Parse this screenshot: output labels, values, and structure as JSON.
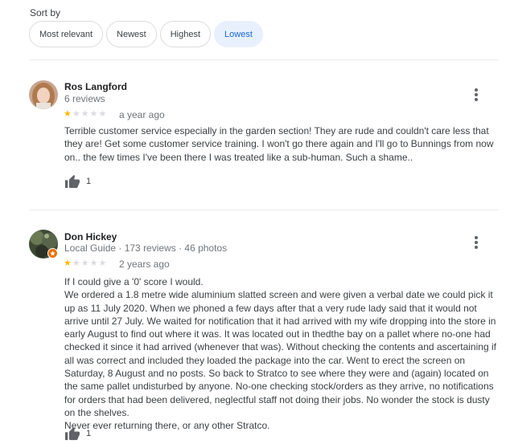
{
  "sort": {
    "label": "Sort by",
    "options": [
      "Most relevant",
      "Newest",
      "Highest",
      "Lowest"
    ],
    "selected": "Lowest"
  },
  "reviews": [
    {
      "author": "Ros Langford",
      "meta": "6 reviews",
      "rating": 1,
      "max_rating": 5,
      "date": "a year ago",
      "paragraphs": [
        "Terrible customer service especially in the garden section!  They are rude and couldn't care less that they are! Get some customer service training. I won't go there again and I'll go to Bunnings from now on.. the few times I've been there I was treated like a sub-human. Such a shame.."
      ],
      "likes": "1"
    },
    {
      "author": "Don Hickey",
      "meta": "Local Guide · 173 reviews · 46 photos",
      "rating": 1,
      "max_rating": 5,
      "date": "2 years ago",
      "paragraphs": [
        "If I could give a '0' score I would.",
        "We ordered a 1.8 metre wide aluminium slatted screen and were given a verbal date we could pick it up as 11 July 2020. When we phoned a few days after that a very rude lady said that it would not arrive until 27 July. We waited for notification that it had arrived with my wife dropping into the store in early August to find out where it was. It was located out in thedthe bay on a pallet where no-one had checked it since it had arrived (whenever that was). Without checking the contents and ascertaining if all was correct and included they loaded the package into the car. Went to erect the screen on Saturday, 8 August and no posts. So back to Stratco to see where they were and (again) located on the same pallet undisturbed by anyone. No-one checking stock/orders as they arrive, no notifications for orders that had been delivered, neglectful staff not doing their jobs. No wonder the stock is dusty on the shelves.",
        "Never ever returning there, or any other Stratco."
      ],
      "likes": "1"
    }
  ],
  "colors": {
    "star_filled": "#fbbc04",
    "star_empty": "#dadce0",
    "chip_selected_bg": "#e8f0fe",
    "chip_selected_text": "#1967d2",
    "local_guide_badge": "#e8710a"
  },
  "icons": [
    "more-vert-icon",
    "thumb-up-icon",
    "local-guide-badge-icon"
  ]
}
